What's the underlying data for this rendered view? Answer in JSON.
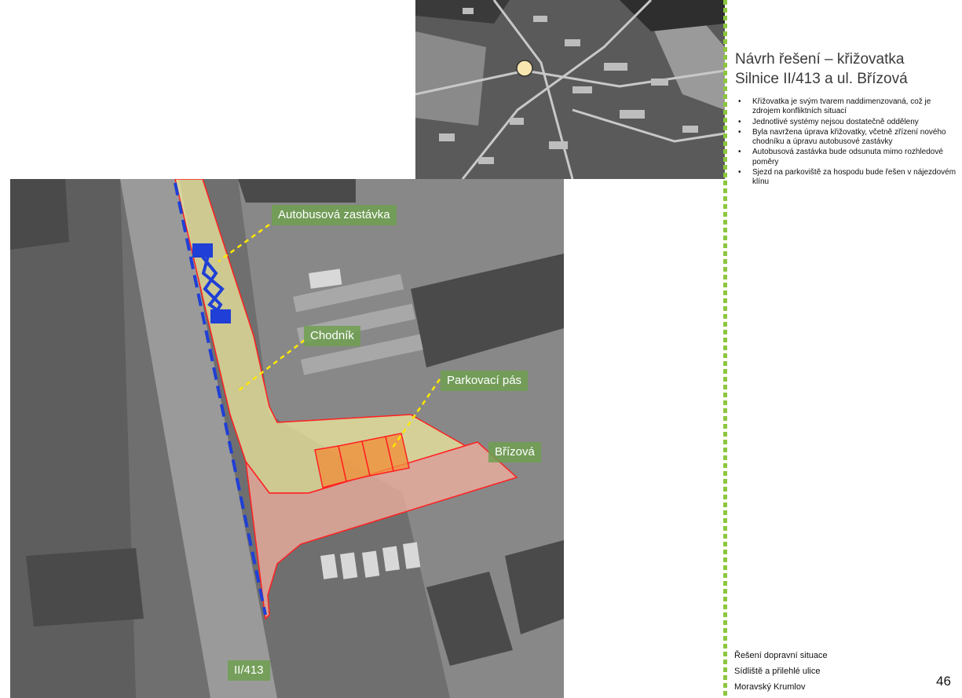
{
  "slide": {
    "title_line1": "Návrh řešení –  křižovatka",
    "title_line2": "Silnice II/413 a ul. Břízová",
    "bullets": [
      "Křižovatka je svým tvarem naddimenzovaná, což je zdrojem konfliktních situací",
      "Jednotlivé systémy nejsou dostatečně odděleny",
      "Byla navržena úprava křižovatky, včetně zřízení nového chodníku a úpravu autobusové zastávky",
      "Autobusová zastávka bude odsunuta mimo rozhledové poměry",
      "Sjezd na parkoviště za hospodu bude řešen v nájezdovém klínu"
    ],
    "footer": [
      "Řešení dopravní situace",
      "Sídliště a přilehlé ulice",
      "Moravský Krumlov"
    ],
    "page_number": "46"
  },
  "map_labels": {
    "bus_stop": "Autobusová zastávka",
    "sidewalk": "Chodník",
    "parking": "Parkovací pás",
    "street": "Břízová",
    "road": "II/413"
  },
  "colors": {
    "divider": "#8cc63f",
    "label_bg": "#6ea050",
    "sidewalk_fill": "#f5f0a0",
    "road_fill": "#f4b0a0",
    "outline": "#ff2020",
    "bus_stop_marking": "#1f3fd6",
    "location_marker": "#f8e6b0"
  }
}
